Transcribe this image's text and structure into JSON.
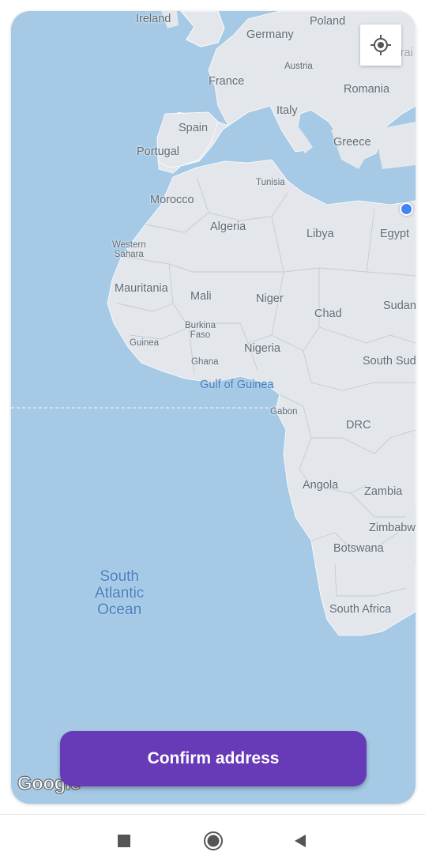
{
  "map": {
    "countries": [
      {
        "id": "ireland",
        "label": "Ireland"
      },
      {
        "id": "germany",
        "label": "Germany"
      },
      {
        "id": "poland",
        "label": "Poland"
      },
      {
        "id": "ukraine",
        "label": "Ukrai"
      },
      {
        "id": "austria",
        "label": "Austria"
      },
      {
        "id": "france",
        "label": "France"
      },
      {
        "id": "romania",
        "label": "Romania"
      },
      {
        "id": "italy",
        "label": "Italy"
      },
      {
        "id": "spain",
        "label": "Spain"
      },
      {
        "id": "greece",
        "label": "Greece"
      },
      {
        "id": "portugal",
        "label": "Portugal"
      },
      {
        "id": "tunisia",
        "label": "Tunisia"
      },
      {
        "id": "morocco",
        "label": "Morocco"
      },
      {
        "id": "algeria",
        "label": "Algeria"
      },
      {
        "id": "libya",
        "label": "Libya"
      },
      {
        "id": "egypt",
        "label": "Egypt"
      },
      {
        "id": "western-sahara",
        "label": "Western\nSahara"
      },
      {
        "id": "mauritania",
        "label": "Mauritania"
      },
      {
        "id": "mali",
        "label": "Mali"
      },
      {
        "id": "niger",
        "label": "Niger"
      },
      {
        "id": "sudan",
        "label": "Sudan"
      },
      {
        "id": "chad",
        "label": "Chad"
      },
      {
        "id": "burkina-faso",
        "label": "Burkina\nFaso"
      },
      {
        "id": "guinea",
        "label": "Guinea"
      },
      {
        "id": "nigeria",
        "label": "Nigeria"
      },
      {
        "id": "ghana",
        "label": "Ghana"
      },
      {
        "id": "south-sudan",
        "label": "South Sud"
      },
      {
        "id": "gabon",
        "label": "Gabon"
      },
      {
        "id": "drc",
        "label": "DRC"
      },
      {
        "id": "angola",
        "label": "Angola"
      },
      {
        "id": "zambia",
        "label": "Zambia"
      },
      {
        "id": "zimbabwe",
        "label": "Zimbabw"
      },
      {
        "id": "botswana",
        "label": "Botswana"
      },
      {
        "id": "south-africa",
        "label": "South Africa"
      }
    ],
    "water": [
      {
        "id": "gulf-of-guinea",
        "label": "Gulf of Guinea"
      },
      {
        "id": "south-atlantic-ocean",
        "label": "South\nAtlantic\nOcean"
      }
    ],
    "locate_icon": "my-location-crosshair-icon",
    "logo_text": "Google"
  },
  "confirm_label": "Confirm address",
  "nav": {
    "recents_icon": "square-stop-icon",
    "home_icon": "circle-home-icon",
    "back_icon": "triangle-back-icon"
  },
  "colors": {
    "water": "#a6cae6",
    "land": "#e3e6ea",
    "accent": "#673ab7",
    "location_dot": "#4285f4"
  }
}
